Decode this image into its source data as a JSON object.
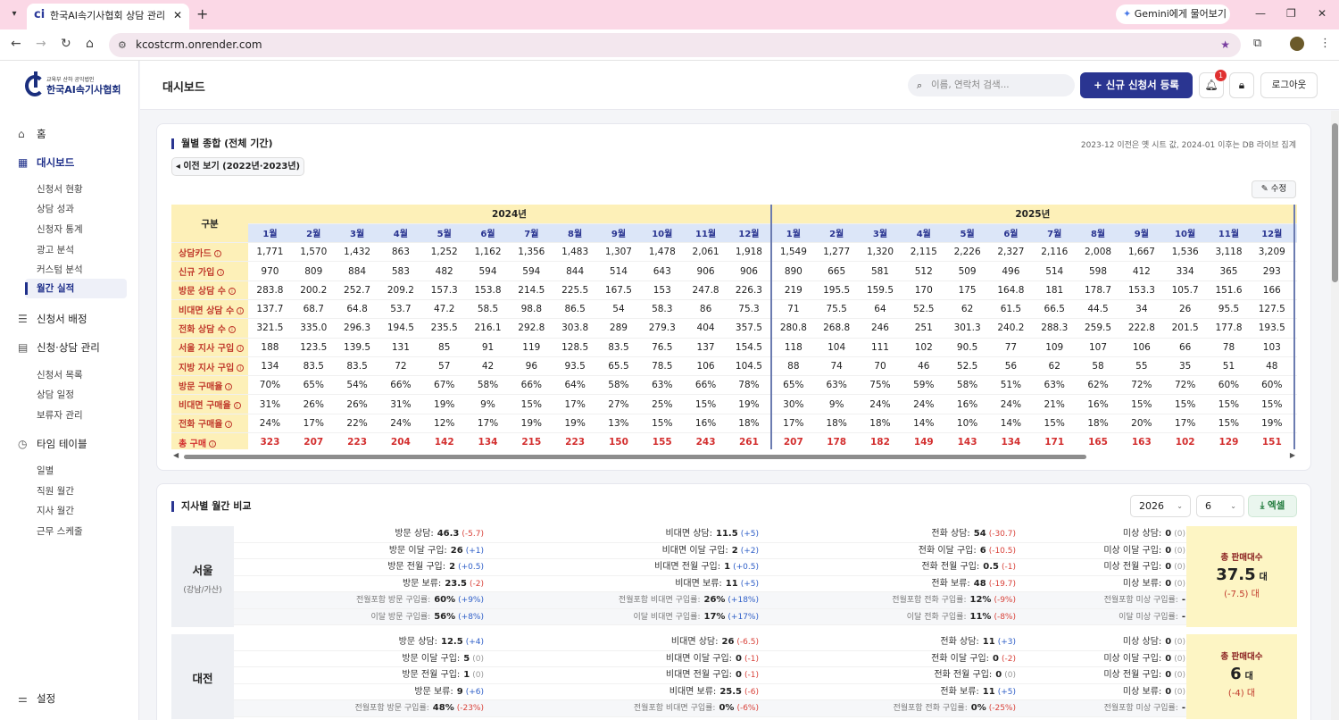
{
  "browser": {
    "tab_title": "한국AI속기사협회 상담 관리 시스템",
    "favicon": "ci",
    "url": "kcostcrm.onrender.com",
    "gemini": "Gemini에게 물어보기"
  },
  "sidebar": {
    "logo_sub": "교육부 산하 공익법인",
    "logo_name": "한국AI속기사협회",
    "home": "홈",
    "dashboard": "대시보드",
    "dashboard_items": [
      "신청서 현황",
      "상담 성과",
      "신청자 통계",
      "광고 분석",
      "커스텀 분석",
      "월간 실적"
    ],
    "assign": "신청서 배정",
    "manage": "신청·상담 관리",
    "manage_items": [
      "신청서 목록",
      "상담 일정",
      "보류자 관리"
    ],
    "timetable": "타임 테이블",
    "timetable_items": [
      "일별",
      "직원 월간",
      "지사 월간",
      "근무 스케줄"
    ],
    "settings": "설정"
  },
  "header": {
    "title": "대시보드",
    "search_placeholder": "이름, 연락처 검색...",
    "new_button": "신규 신청서 등록",
    "notif_count": "1",
    "logout": "로그아웃"
  },
  "monthly": {
    "title": "월별 종합 (전체 기간)",
    "note": "2023-12 이전은 옛 시트 값, 2024-01 이후는 DB 라이브 집계",
    "prev_button": "◂ 이전 보기 (2022년·2023년)",
    "edit_button": "수정",
    "gubun": "구분",
    "year_2024": "2024년",
    "year_2025": "2025년",
    "months": [
      "1월",
      "2월",
      "3월",
      "4월",
      "5월",
      "6월",
      "7월",
      "8월",
      "9월",
      "10월",
      "11월",
      "12월"
    ],
    "rows": [
      {
        "label": "상담카드",
        "v": [
          "1,771",
          "1,570",
          "1,432",
          "863",
          "1,252",
          "1,162",
          "1,356",
          "1,483",
          "1,307",
          "1,478",
          "2,061",
          "1,918",
          "1,549",
          "1,277",
          "1,320",
          "2,115",
          "2,226",
          "2,327",
          "2,116",
          "2,008",
          "1,667",
          "1,536",
          "3,118",
          "3,209"
        ]
      },
      {
        "label": "신규 가입",
        "v": [
          "970",
          "809",
          "884",
          "583",
          "482",
          "594",
          "594",
          "844",
          "514",
          "643",
          "906",
          "906",
          "890",
          "665",
          "581",
          "512",
          "509",
          "496",
          "514",
          "598",
          "412",
          "334",
          "365",
          "293"
        ]
      },
      {
        "label": "방문 상담 수",
        "v": [
          "283.8",
          "200.2",
          "252.7",
          "209.2",
          "157.3",
          "153.8",
          "214.5",
          "225.5",
          "167.5",
          "153",
          "247.8",
          "226.3",
          "219",
          "195.5",
          "159.5",
          "170",
          "175",
          "164.8",
          "181",
          "178.7",
          "153.3",
          "105.7",
          "151.6",
          "166"
        ]
      },
      {
        "label": "비대면 상담 수",
        "v": [
          "137.7",
          "68.7",
          "64.8",
          "53.7",
          "47.2",
          "58.5",
          "98.8",
          "86.5",
          "54",
          "58.3",
          "86",
          "75.3",
          "71",
          "75.5",
          "64",
          "52.5",
          "62",
          "61.5",
          "66.5",
          "44.5",
          "34",
          "26",
          "95.5",
          "127.5"
        ]
      },
      {
        "label": "전화 상담 수",
        "v": [
          "321.5",
          "335.0",
          "296.3",
          "194.5",
          "235.5",
          "216.1",
          "292.8",
          "303.8",
          "289",
          "279.3",
          "404",
          "357.5",
          "280.8",
          "268.8",
          "246",
          "251",
          "301.3",
          "240.2",
          "288.3",
          "259.5",
          "222.8",
          "201.5",
          "177.8",
          "193.5"
        ]
      },
      {
        "label": "서울 지사 구입",
        "v": [
          "188",
          "123.5",
          "139.5",
          "131",
          "85",
          "91",
          "119",
          "128.5",
          "83.5",
          "76.5",
          "137",
          "154.5",
          "118",
          "104",
          "111",
          "102",
          "90.5",
          "77",
          "109",
          "107",
          "106",
          "66",
          "78",
          "103"
        ]
      },
      {
        "label": "지방 지사 구입",
        "v": [
          "134",
          "83.5",
          "83.5",
          "72",
          "57",
          "42",
          "96",
          "93.5",
          "65.5",
          "78.5",
          "106",
          "104.5",
          "88",
          "74",
          "70",
          "46",
          "52.5",
          "56",
          "62",
          "58",
          "55",
          "35",
          "51",
          "48"
        ]
      },
      {
        "label": "방문 구매율",
        "v": [
          "70%",
          "65%",
          "54%",
          "66%",
          "67%",
          "58%",
          "66%",
          "64%",
          "58%",
          "63%",
          "66%",
          "78%",
          "65%",
          "63%",
          "75%",
          "59%",
          "58%",
          "51%",
          "63%",
          "62%",
          "72%",
          "72%",
          "60%",
          "60%"
        ]
      },
      {
        "label": "비대면 구매율",
        "v": [
          "31%",
          "26%",
          "26%",
          "31%",
          "19%",
          "9%",
          "15%",
          "17%",
          "27%",
          "25%",
          "15%",
          "19%",
          "30%",
          "9%",
          "24%",
          "24%",
          "16%",
          "24%",
          "21%",
          "16%",
          "15%",
          "15%",
          "15%",
          "15%"
        ]
      },
      {
        "label": "전화 구매율",
        "v": [
          "24%",
          "17%",
          "22%",
          "24%",
          "12%",
          "17%",
          "19%",
          "19%",
          "13%",
          "15%",
          "16%",
          "18%",
          "17%",
          "18%",
          "18%",
          "14%",
          "10%",
          "14%",
          "15%",
          "18%",
          "20%",
          "17%",
          "15%",
          "19%"
        ]
      },
      {
        "label": "총 구매",
        "v": [
          "323",
          "207",
          "223",
          "204",
          "142",
          "134",
          "215",
          "223",
          "150",
          "155",
          "243",
          "261",
          "207",
          "178",
          "182",
          "149",
          "143",
          "134",
          "171",
          "165",
          "163",
          "102",
          "129",
          "151"
        ]
      }
    ]
  },
  "branch_cmp": {
    "title": "지사별 월간 비교",
    "year": "2026",
    "month": "6",
    "excel": "엑셀",
    "total_label": "총 판매대수",
    "unit": "대",
    "branches": [
      {
        "name": "서울",
        "sub": "(강남/가산)",
        "total": "37.5",
        "total_delta": "(-7.5) 대",
        "rows": [
          [
            [
              "방문 상담:",
              "46.3",
              "(-5.7)"
            ],
            [
              "비대면 상담:",
              "11.5",
              "(+5)"
            ],
            [
              "전화 상담:",
              "54",
              "(-30.7)"
            ],
            [
              "미상 상담:",
              "0",
              "(0)"
            ]
          ],
          [
            [
              "방문 이달 구입:",
              "26",
              "(+1)"
            ],
            [
              "비대면 이달 구입:",
              "2",
              "(+2)"
            ],
            [
              "전화 이달 구입:",
              "6",
              "(-10.5)"
            ],
            [
              "미상 이달 구입:",
              "0",
              "(0)"
            ]
          ],
          [
            [
              "방문 전월 구입:",
              "2",
              "(+0.5)"
            ],
            [
              "비대면 전월 구입:",
              "1",
              "(+0.5)"
            ],
            [
              "전화 전월 구입:",
              "0.5",
              "(-1)"
            ],
            [
              "미상 전월 구입:",
              "0",
              "(0)"
            ]
          ],
          [
            [
              "방문 보류:",
              "23.5",
              "(-2)"
            ],
            [
              "비대면 보류:",
              "11",
              "(+5)"
            ],
            [
              "전화 보류:",
              "48",
              "(-19.7)"
            ],
            [
              "미상 보류:",
              "0",
              "(0)"
            ]
          ],
          [
            [
              "전월포함 방문 구입률:",
              "60%",
              "(+9%)"
            ],
            [
              "전월포함 비대면 구입률:",
              "26%",
              "(+18%)"
            ],
            [
              "전월포함 전화 구입률:",
              "12%",
              "(-9%)"
            ],
            [
              "전월포함 미상 구입률:",
              "-",
              ""
            ]
          ],
          [
            [
              "이달 방문 구입률:",
              "56%",
              "(+8%)"
            ],
            [
              "이달 비대면 구입률:",
              "17%",
              "(+17%)"
            ],
            [
              "이달 전화 구입률:",
              "11%",
              "(-8%)"
            ],
            [
              "이달 미상 구입률:",
              "-",
              ""
            ]
          ]
        ]
      },
      {
        "name": "대전",
        "sub": "",
        "total": "6",
        "total_delta": "(-4) 대",
        "rows": [
          [
            [
              "방문 상담:",
              "12.5",
              "(+4)"
            ],
            [
              "비대면 상담:",
              "26",
              "(-6.5)"
            ],
            [
              "전화 상담:",
              "11",
              "(+3)"
            ],
            [
              "미상 상담:",
              "0",
              "(0)"
            ]
          ],
          [
            [
              "방문 이달 구입:",
              "5",
              "(0)"
            ],
            [
              "비대면 이달 구입:",
              "0",
              "(-1)"
            ],
            [
              "전화 이달 구입:",
              "0",
              "(-2)"
            ],
            [
              "미상 이달 구입:",
              "0",
              "(0)"
            ]
          ],
          [
            [
              "방문 전월 구입:",
              "1",
              "(0)"
            ],
            [
              "비대면 전월 구입:",
              "0",
              "(-1)"
            ],
            [
              "전화 전월 구입:",
              "0",
              "(0)"
            ],
            [
              "미상 전월 구입:",
              "0",
              "(0)"
            ]
          ],
          [
            [
              "방문 보류:",
              "9",
              "(+6)"
            ],
            [
              "비대면 보류:",
              "25.5",
              "(-6)"
            ],
            [
              "전화 보류:",
              "11",
              "(+5)"
            ],
            [
              "미상 보류:",
              "0",
              "(0)"
            ]
          ],
          [
            [
              "전월포함 방문 구입률:",
              "48%",
              "(-23%)"
            ],
            [
              "전월포함 비대면 구입률:",
              "0%",
              "(-6%)"
            ],
            [
              "전월포함 전화 구입률:",
              "0%",
              "(-25%)"
            ],
            [
              "전월포함 미상 구입률:",
              "-",
              ""
            ]
          ]
        ]
      }
    ]
  }
}
